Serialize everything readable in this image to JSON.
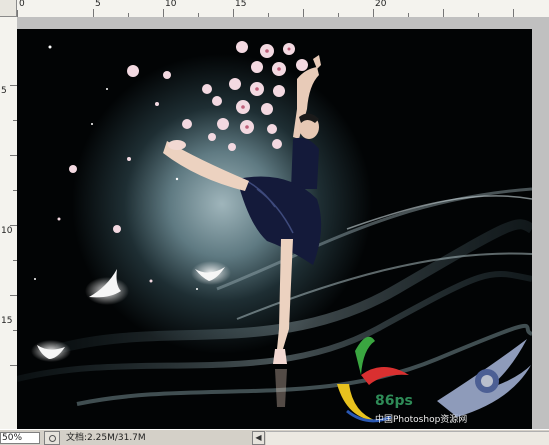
{
  "app": {
    "name": "Photoshop"
  },
  "ruler": {
    "h_labels": [
      "0",
      "5",
      "10",
      "15",
      "20"
    ],
    "v_labels": [
      "5",
      "10",
      "15"
    ]
  },
  "status": {
    "zoom": "50%",
    "doc_info": "文档:2.25M/31.7M"
  },
  "watermark": {
    "logo_text": "86ps",
    "site_text": "中国Photoshop资源网"
  },
  "colors": {
    "canvas_bg": "#020405",
    "glow": "#8aa3ab",
    "tutu": "#141a3a",
    "blossom": "#f3d9e1",
    "ruler_bg": "#f4f3ee",
    "chrome": "#d4d0c8"
  },
  "icons": [
    "status-menu-icon",
    "scroll-left-arrow-icon"
  ]
}
